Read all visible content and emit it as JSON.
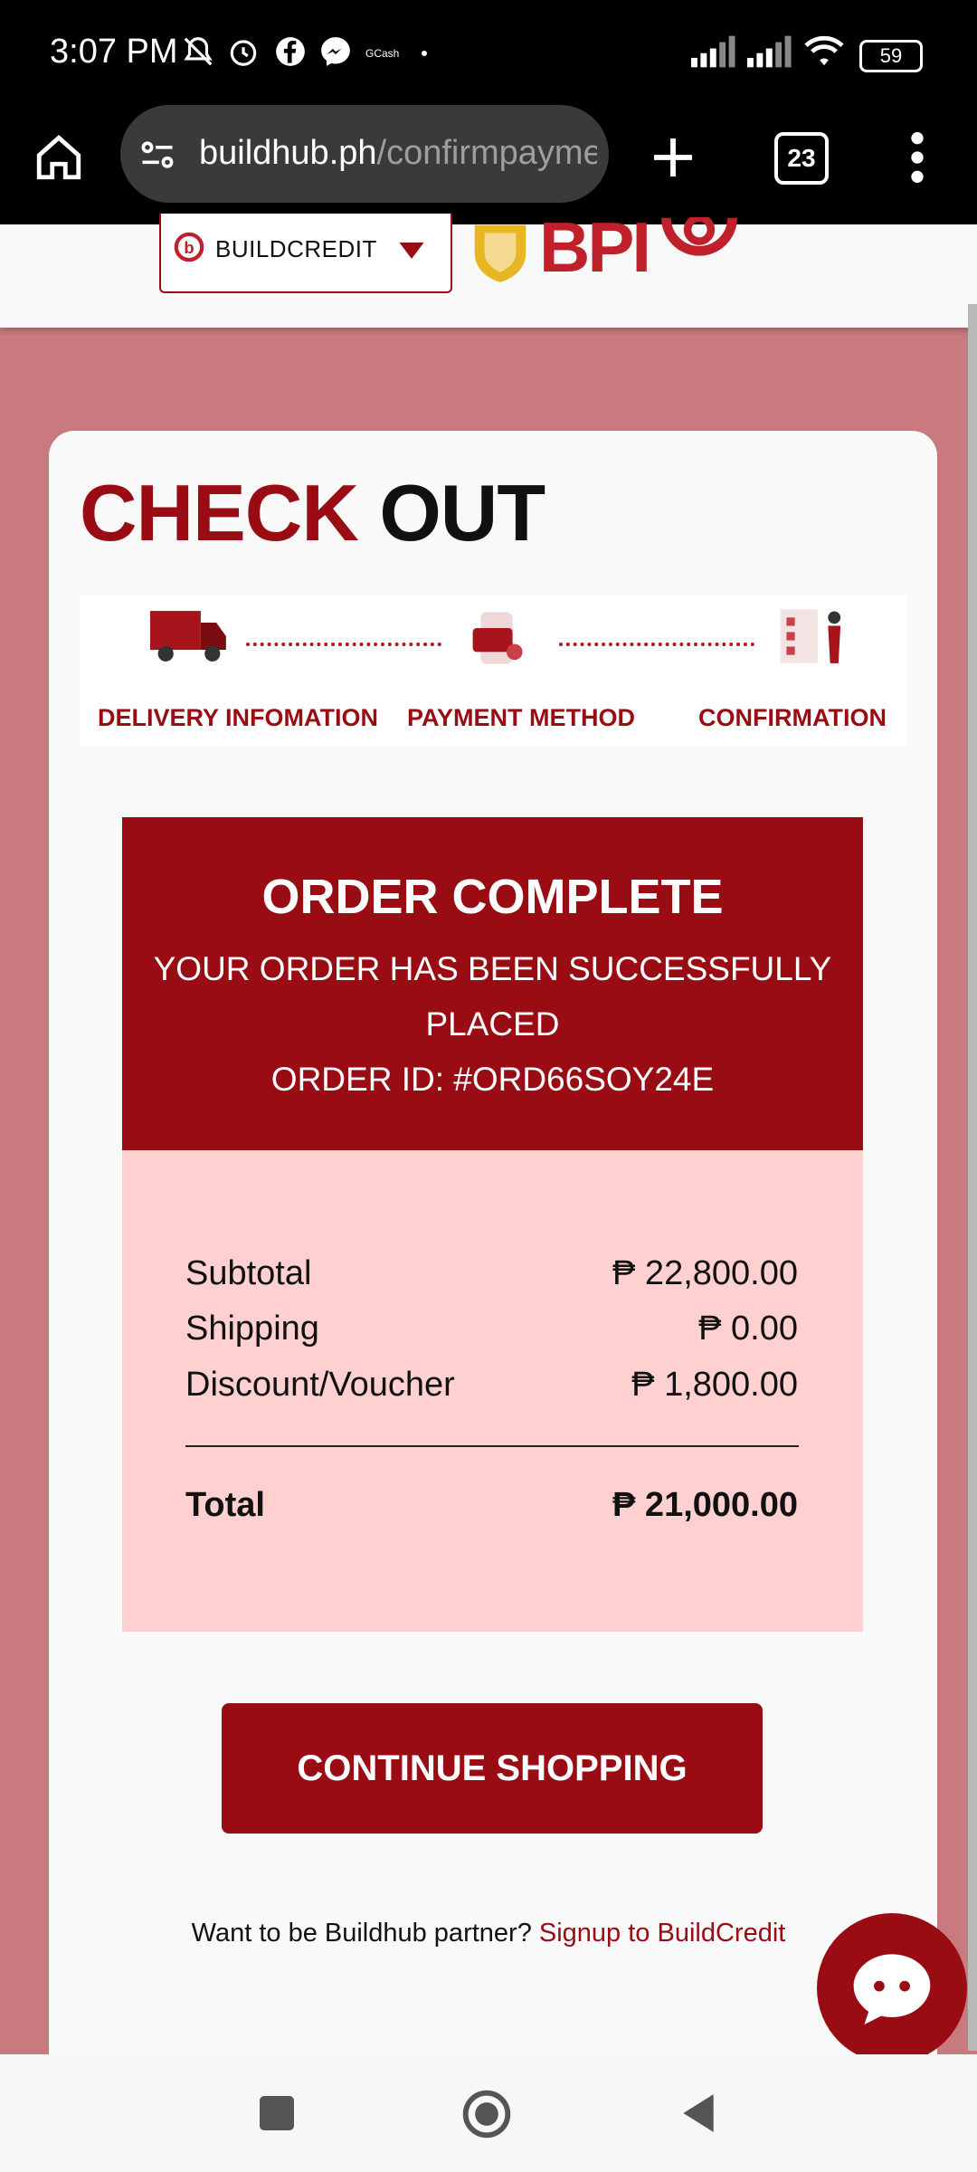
{
  "status_bar": {
    "time": "3:07 PM",
    "gcash_label": "GCash",
    "battery": "59"
  },
  "browser": {
    "url_domain": "buildhub.ph",
    "url_path": "/confirmpayme",
    "tab_count": "23"
  },
  "header": {
    "credit_select": "BUILDCREDIT",
    "partner_logo": "BPI"
  },
  "checkout": {
    "title_part1": "CHECK",
    "title_part2": "OUT",
    "steps": [
      {
        "label": "DELIVERY INFOMATION"
      },
      {
        "label": "PAYMENT METHOD"
      },
      {
        "label": "CONFIRMATION"
      }
    ]
  },
  "order": {
    "title": "ORDER COMPLETE",
    "line1": "YOUR ORDER HAS BEEN SUCCESSFULLY",
    "line2": "PLACED",
    "order_id": "ORDER ID: #ORD66SOY24E",
    "summary": {
      "subtotal_label": "Subtotal",
      "subtotal_value": "₱ 22,800.00",
      "shipping_label": "Shipping",
      "shipping_value": "₱ 0.00",
      "discount_label": "Discount/Voucher",
      "discount_value": "₱ 1,800.00",
      "total_label": "Total",
      "total_value": "₱ 21,000.00"
    }
  },
  "actions": {
    "continue_label": "CONTINUE SHOPPING",
    "partner_prompt": "Want to be Buildhub partner?",
    "partner_link": "Signup to BuildCredit"
  },
  "colors": {
    "brand_red": "#9a0c13",
    "summary_bg": "#fed0d0",
    "page_bg": "#c97a7e"
  }
}
